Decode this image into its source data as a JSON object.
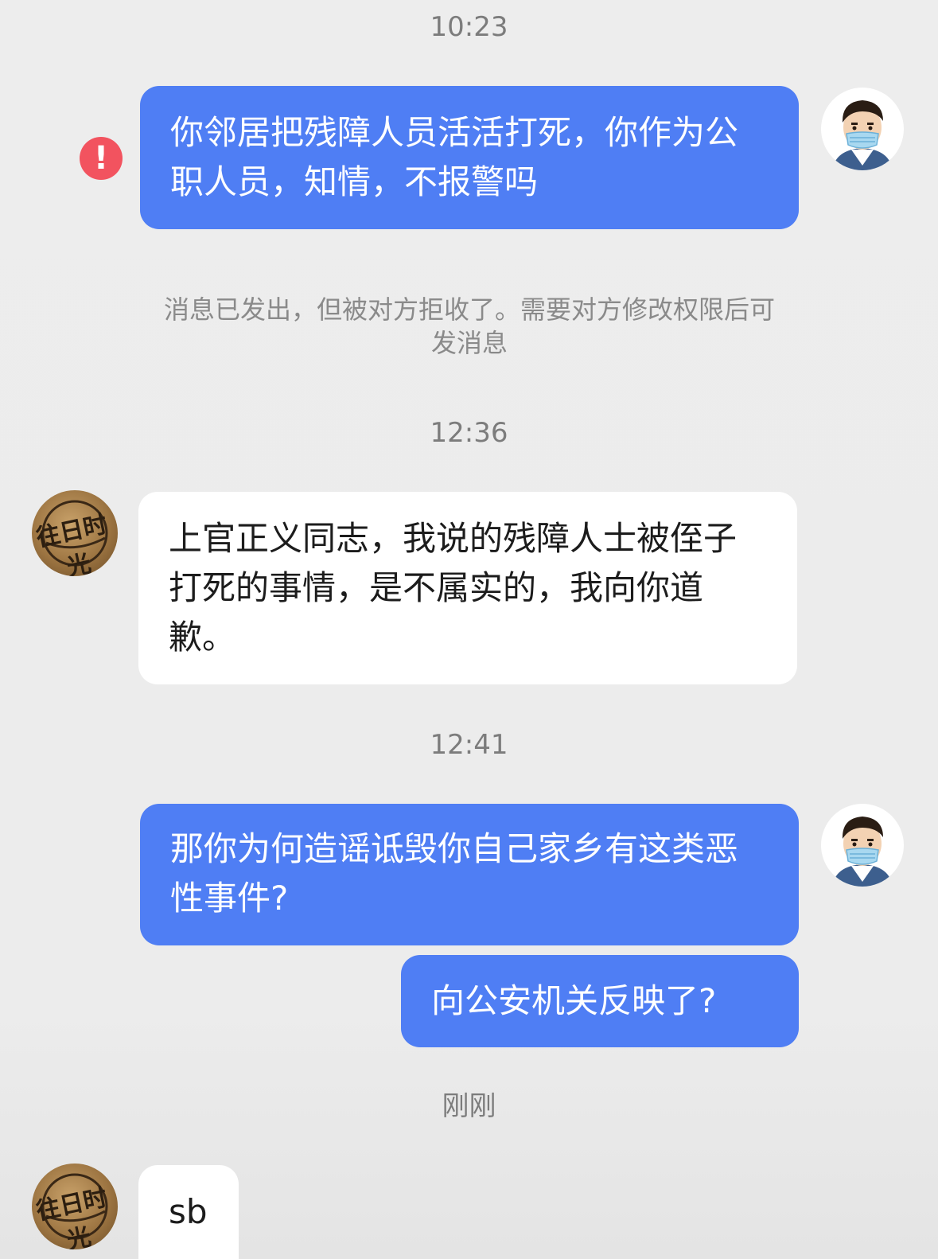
{
  "messages": {
    "time1": "10:23",
    "msg1": "你邻居把残障人员活活打死，你作为公职人员，知情，不报警吗",
    "error_glyph": "!",
    "notice": "消息已发出，但被对方拒收了。需要对方修改权限后可发消息",
    "time2": "12:36",
    "msg2": "上官正义同志，我说的残障人士被侄子打死的事情，是不属实的，我向你道歉。",
    "time3": "12:41",
    "msg3": "那你为何造谣诋毁你自己家乡有这类恶性事件?",
    "msg4": "向公安机关反映了?",
    "time4": "刚刚",
    "msg5": "sb"
  },
  "avatars": {
    "other_logo_text": "往日时光"
  },
  "colors": {
    "sent_bubble": "#4f7ef4",
    "received_bubble": "#ffffff",
    "error_badge": "#f2535f",
    "background": "#ededed"
  },
  "icons": {
    "error": "exclamation-circle-icon",
    "me_avatar": "masked-man-avatar-icon",
    "other_avatar": "wood-logo-avatar-icon"
  }
}
